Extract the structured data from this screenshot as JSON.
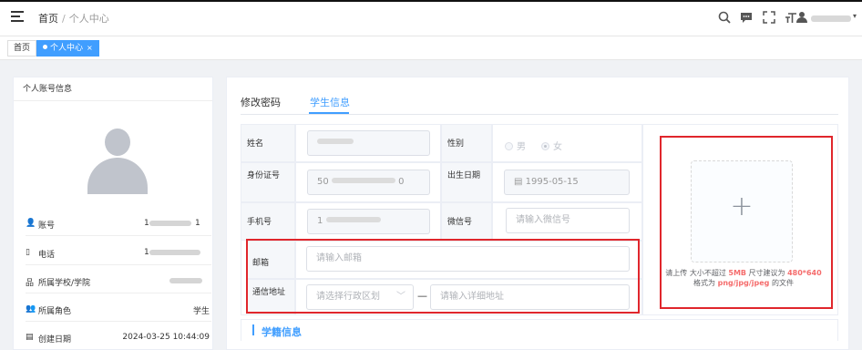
{
  "header": {
    "breadcrumb": {
      "home": "首页",
      "separator": "/",
      "current": "个人中心"
    },
    "icons": [
      "search-icon",
      "chat-icon",
      "fullscreen-icon",
      "font-size-icon",
      "user-icon"
    ]
  },
  "tags": [
    {
      "label": "首页"
    },
    {
      "label": "个人中心",
      "close": "×"
    }
  ],
  "left_panel": {
    "title": "个人账号信息",
    "rows": [
      {
        "icon": "👤",
        "label": "账号",
        "value": "1",
        "suffix": "1"
      },
      {
        "icon": "▯",
        "label": "电话",
        "value": "1"
      },
      {
        "icon": "品",
        "label": "所属学校/学院",
        "value": ""
      },
      {
        "icon": "👥",
        "label": "所属角色",
        "value": "学生"
      },
      {
        "icon": "▤",
        "label": "创建日期",
        "value": "2024-03-25 10:44:09"
      }
    ]
  },
  "tabs": [
    {
      "label": "修改密码"
    },
    {
      "label": "学生信息"
    }
  ],
  "form": {
    "name_label": "姓名",
    "gender_label": "性别",
    "gender_male": "男",
    "gender_female": "女",
    "idcard_label": "身份证号",
    "idcard_prefix": "50",
    "idcard_suffix": "0",
    "birth_label": "出生日期",
    "birth_value": "1995-05-15",
    "phone_label": "手机号",
    "phone_prefix": "1",
    "wechat_label": "微信号",
    "wechat_placeholder": "请输入微信号",
    "email_label": "邮箱",
    "email_placeholder": "请输入邮箱",
    "address_label": "通信地址",
    "region_placeholder": "请选择行政区划",
    "address_dash": "—",
    "address_placeholder": "请输入详细地址"
  },
  "upload": {
    "plus": "+",
    "tip_1": "请上传 大小不超过 ",
    "tip_size": "5MB",
    "tip_2": " 尺寸建议为 ",
    "tip_dim": "480*640",
    "tip_3": "格式为 ",
    "tip_fmt": "png/jpg/jpeg",
    "tip_4": " 的文件"
  },
  "section": {
    "title": "学籍信息"
  },
  "colors": {
    "accent": "#409eff",
    "highlight": "#e0262c",
    "warn": "#f56c6c"
  }
}
